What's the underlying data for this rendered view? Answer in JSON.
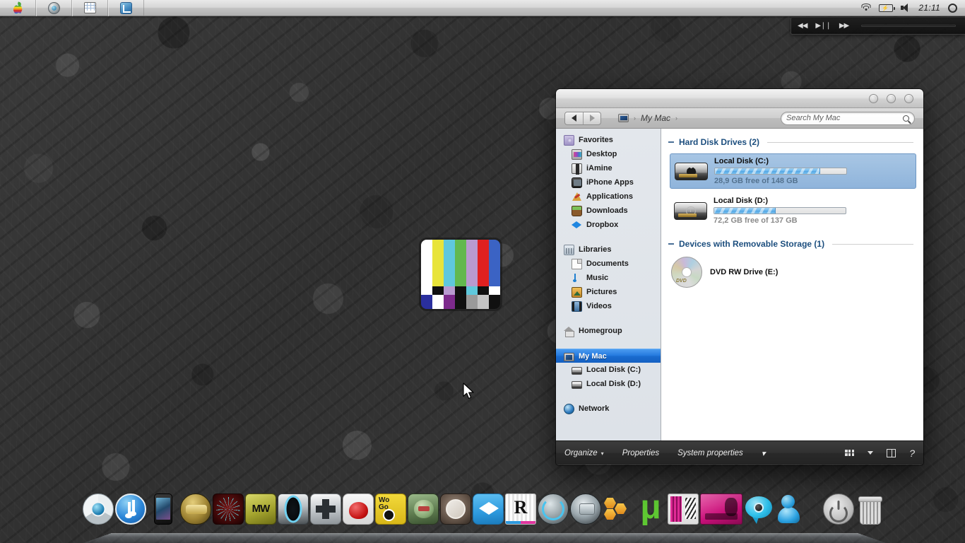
{
  "menubar": {
    "apple_logo": "apple-logo",
    "icons": [
      "apple-logo-icon",
      "globe-icon",
      "calendar-icon",
      "window-manager-icon"
    ],
    "status_icons": [
      "wifi-icon",
      "battery-icon",
      "volume-icon",
      "spotlight-icon"
    ],
    "time": "21:11"
  },
  "media_widget": {
    "prev_label": "◀◀",
    "play_label": "▶❘❘",
    "next_label": "▶▶"
  },
  "window": {
    "title": "My Mac",
    "traffic_lights": [
      "close",
      "minimize",
      "zoom"
    ],
    "nav": {
      "back": "back-arrow",
      "forward": "forward-arrow"
    },
    "breadcrumb": {
      "icon": "computer-icon",
      "sep1": "›",
      "label": "My Mac",
      "sep2": "›"
    },
    "search": {
      "placeholder": "Search My Mac",
      "value": ""
    }
  },
  "sidebar": {
    "groups": [
      {
        "header": {
          "label": "Favorites",
          "icon": "favorites-folder-icon"
        },
        "items": [
          {
            "label": "Desktop",
            "icon": "desktop-icon"
          },
          {
            "label": "iAmine",
            "icon": "user-home-icon"
          },
          {
            "label": "iPhone Apps",
            "icon": "iphone-icon"
          },
          {
            "label": "Applications",
            "icon": "applications-icon"
          },
          {
            "label": "Downloads",
            "icon": "downloads-icon"
          },
          {
            "label": "Dropbox",
            "icon": "dropbox-icon"
          }
        ]
      },
      {
        "header": {
          "label": "Libraries",
          "icon": "libraries-icon"
        },
        "items": [
          {
            "label": "Documents",
            "icon": "document-icon"
          },
          {
            "label": "Music",
            "icon": "music-note-icon"
          },
          {
            "label": "Pictures",
            "icon": "pictures-icon"
          },
          {
            "label": "Videos",
            "icon": "video-film-icon"
          }
        ]
      },
      {
        "header": {
          "label": "Homegroup",
          "icon": "homegroup-house-icon"
        },
        "items": []
      },
      {
        "header": {
          "label": "My Mac",
          "icon": "computer-icon",
          "selected": true
        },
        "items": [
          {
            "label": "Local Disk (C:)",
            "icon": "hard-disk-icon"
          },
          {
            "label": "Local Disk (D:)",
            "icon": "hard-disk-icon"
          }
        ]
      },
      {
        "header": {
          "label": "Network",
          "icon": "network-globe-icon"
        },
        "items": []
      }
    ]
  },
  "content": {
    "groups": [
      {
        "title": "Hard Disk Drives (2)",
        "collapse_glyph": "minus-icon",
        "drives": [
          {
            "name": "Local Disk (C:)",
            "free_text": "28,9 GB free of 148 GB",
            "used_percent": 80,
            "icon": "hard-disk-apple-icon",
            "selected": true
          },
          {
            "name": "Local Disk (D:)",
            "free_text": "72,2 GB free of 137 GB",
            "used_percent": 47,
            "icon": "hard-disk-clock-icon",
            "selected": false
          }
        ]
      },
      {
        "title": "Devices with Removable Storage (1)",
        "collapse_glyph": "minus-icon",
        "devices": [
          {
            "name": "DVD RW Drive (E:)",
            "icon": "dvd-disc-icon",
            "disc_label": "DVD"
          }
        ]
      }
    ]
  },
  "command_bar": {
    "organize": "Organize",
    "organize_caret": "▾",
    "properties": "Properties",
    "system_properties": "System properties",
    "overflow_caret": "▾",
    "right_icons": [
      "view-grid-icon",
      "view-caret-icon",
      "preview-pane-icon",
      "help-icon"
    ],
    "help_glyph": "?"
  },
  "dock": {
    "items": [
      {
        "name": "chrome"
      },
      {
        "name": "itunes"
      },
      {
        "name": "iphone"
      },
      {
        "name": "halo"
      },
      {
        "name": "spiral-game"
      },
      {
        "name": "modern-warfare"
      },
      {
        "name": "portal"
      },
      {
        "name": "dpad-game"
      },
      {
        "name": "angry-birds"
      },
      {
        "name": "world-of-goo"
      },
      {
        "name": "plants-vs-zombies"
      },
      {
        "name": "cydia"
      },
      {
        "name": "dropbox"
      },
      {
        "name": "reeder"
      },
      {
        "name": "time-machine"
      },
      {
        "name": "stacks"
      },
      {
        "name": "hex-tools"
      },
      {
        "name": "utorrent"
      },
      {
        "name": "pink-app"
      },
      {
        "name": "music-widget"
      },
      {
        "name": "ichat"
      },
      {
        "name": "msn-messenger"
      },
      {
        "name": "power"
      },
      {
        "name": "trash"
      }
    ]
  },
  "tv_widget": {
    "name": "tv-test-pattern",
    "bar_colors": [
      "#ffffff",
      "#e8e43a",
      "#5fc8dc",
      "#62b84e",
      "#b99ad0",
      "#e02020",
      "#3b63c4"
    ],
    "mid_colors": [
      "#ffffff",
      "#101010",
      "#b99ad0",
      "#101010",
      "#5fc8dc",
      "#101010",
      "#ffffff"
    ],
    "bot_colors": [
      "#2a2f9e",
      "#ffffff",
      "#7d2a8c",
      "#101010",
      "#9a9a9a",
      "#c4c4c4",
      "#101010"
    ]
  }
}
